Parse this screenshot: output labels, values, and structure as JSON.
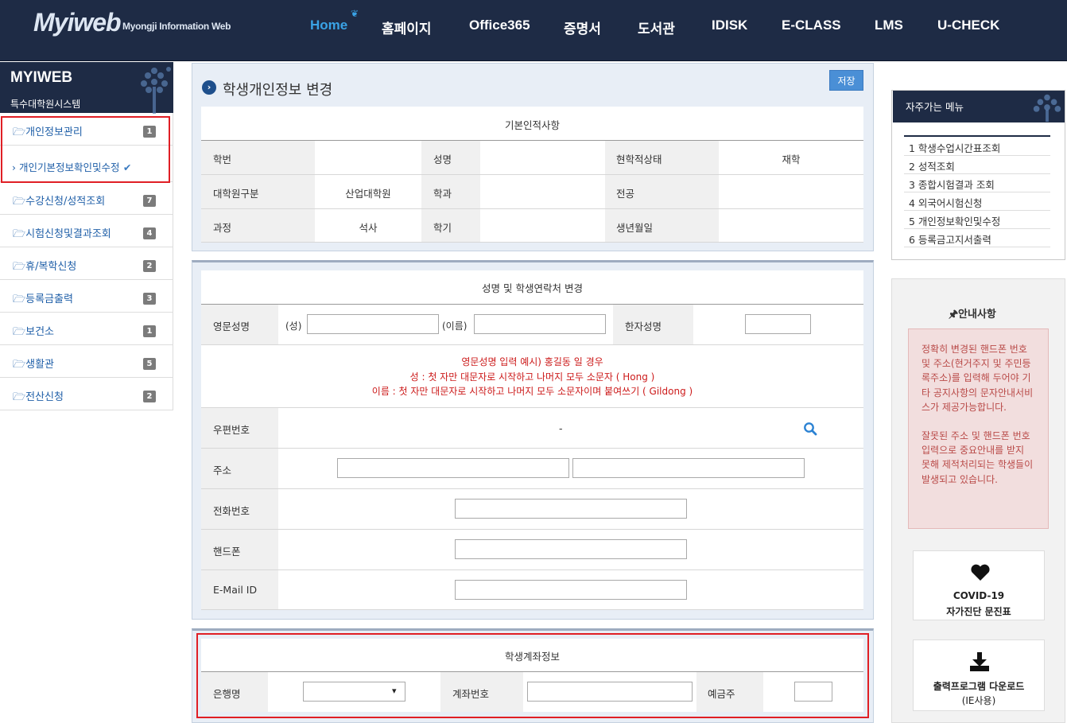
{
  "header": {
    "logo": "Myiweb",
    "logo_sub": "Myongji Information Web",
    "nav": [
      "Home",
      "홈페이지",
      "Office365",
      "증명서",
      "도서관",
      "IDISK",
      "E-CLASS",
      "LMS",
      "U-CHECK"
    ]
  },
  "sidebar": {
    "title": "MYIWEB",
    "subtitle": "특수대학원시스템",
    "items": [
      {
        "label": "개인정보관리",
        "count": "1"
      },
      {
        "label": "개인기본정보확인및수정"
      },
      {
        "label": "수강신청/성적조회",
        "count": "7"
      },
      {
        "label": "시험신청및결과조회",
        "count": "4"
      },
      {
        "label": "휴/복학신청",
        "count": "2"
      },
      {
        "label": "등록금출력",
        "count": "3"
      },
      {
        "label": "보건소",
        "count": "1"
      },
      {
        "label": "생활관",
        "count": "5"
      },
      {
        "label": "전산신청",
        "count": "2"
      }
    ]
  },
  "main": {
    "title": "학생개인정보 변경",
    "save_label": "저장",
    "basic": {
      "heading": "기본인적사항",
      "student_no_label": "학번",
      "name_label": "성명",
      "status_label": "현학적상태",
      "status_value": "재학",
      "grad_type_label": "대학원구분",
      "grad_type_value": "산업대학원",
      "dept_label": "학과",
      "major_label": "전공",
      "course_label": "과정",
      "course_value": "석사",
      "semester_label": "학기",
      "birth_label": "생년월일"
    },
    "contact": {
      "heading": "성명 및 학생연락처 변경",
      "eng_name_label": "영문성명",
      "last_label": "(성)",
      "first_label": "(이름)",
      "hanja_label": "한자성명",
      "example_line1": "영문성명 입력 예시) 홍길동 일 경우",
      "example_line2": "성 : 첫 자만 대문자로 시작하고 나머지 모두 소문자 ( Hong )",
      "example_line3": "이름 : 첫 자만 대문자로 시작하고 나머지 모두 소문자이며 붙여쓰기 ( Gildong )",
      "zip_label": "우편번호",
      "zip_value": "-",
      "address_label": "주소",
      "phone_label": "전화번호",
      "mobile_label": "핸드폰",
      "email_label": "E-Mail ID"
    },
    "account": {
      "heading": "학생계좌정보",
      "bank_label": "은행명",
      "account_no_label": "계좌번호",
      "holder_label": "예금주"
    }
  },
  "right": {
    "favorites_title": "자주가는 메뉴",
    "favorites": [
      "1 학생수업시간표조회",
      "2 성적조회",
      "3 종합시험결과 조회",
      "4 외국어시험신청",
      "5 개인정보확인및수정",
      "6 등록금고지서출력"
    ],
    "notice_title": "안내사항",
    "notice_p1": "정확히 변경된 핸드폰 번호 및 주소(현거주지 및 주민등록주소)를 입력해 두어야 기타 공지사항의 문자안내서비스가 제공가능합니다.",
    "notice_p2": "잘못된 주소 및 핸드폰 번호입력으로 중요안내를 받지 못해 제적처리되는 학생들이 발생되고 있습니다.",
    "covid_line1": "COVID-19",
    "covid_line2": "자가진단 문진표",
    "print_line1": "출력프로그램 다운로드",
    "print_line2": "(IE사용)"
  }
}
